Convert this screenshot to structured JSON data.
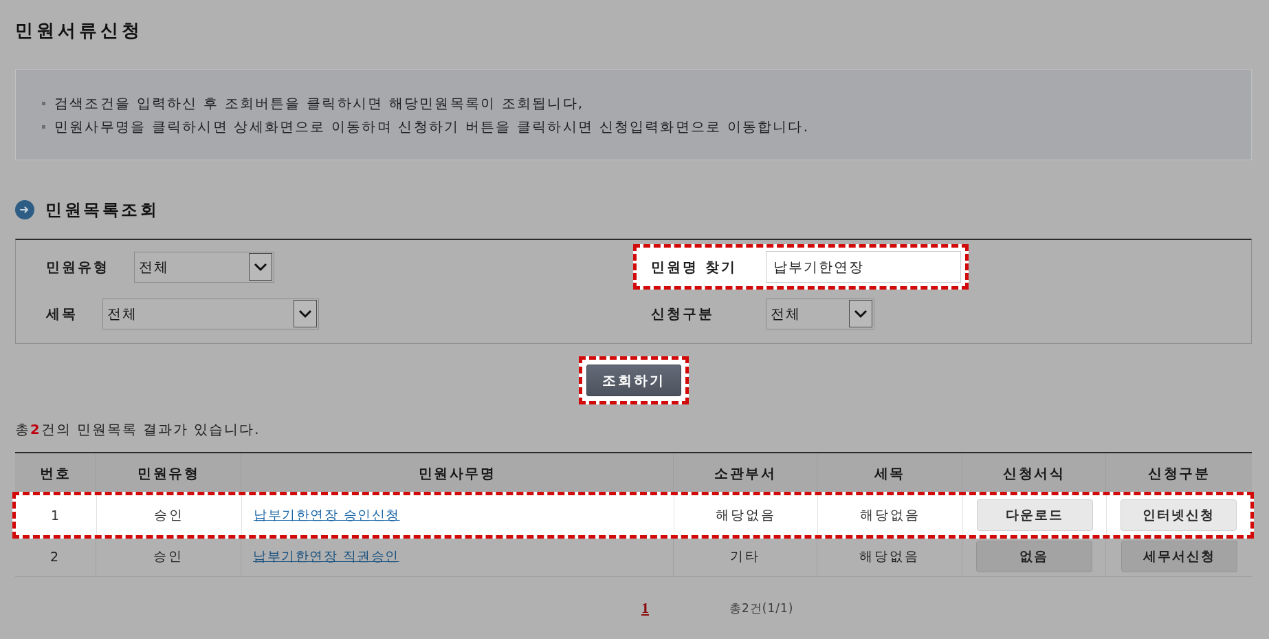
{
  "page_title": "민원서류신청",
  "notice": {
    "items": [
      "검색조건을 입력하신 후 조회버튼을 클릭하시면 해당민원목록이 조회됩니다,",
      "민원사무명을 클릭하시면 상세화면으로 이동하며 신청하기 버튼을 클릭하시면 신청입력화면으로 이동합니다."
    ]
  },
  "section": {
    "title": "민원목록조회"
  },
  "search_form": {
    "fields": [
      {
        "kind": "select",
        "label": "민원유형",
        "value": "전체",
        "highlighted": false
      },
      {
        "kind": "text",
        "label": "민원명 찾기",
        "value": "납부기한연장",
        "highlighted": true
      },
      {
        "kind": "select",
        "label": "세목",
        "value": "전체",
        "highlighted": false
      },
      {
        "kind": "select",
        "label": "신청구분",
        "value": "전체",
        "highlighted": false
      }
    ],
    "button": {
      "label": "조회하기",
      "highlighted": true
    }
  },
  "result_summary": "총**2**건의 민원목록 결과가 있습니다.",
  "table": {
    "columns": [
      "번호",
      "민원유형",
      "민원사무명",
      "소관부서",
      "세목",
      "신청서식",
      "신청구분"
    ],
    "rows": [
      {
        "number": "1",
        "type": "승인",
        "service_name": "납부기한연장 승인신청",
        "department": "해당없음",
        "tax_item": "해당없음",
        "form_button": "다운로드",
        "apply_button": "인터넷신청",
        "highlighted": true
      },
      {
        "number": "2",
        "type": "승인",
        "service_name": "납부기한연장 직권승인",
        "department": "기타",
        "tax_item": "해당없음",
        "form_button": "없음",
        "apply_button": "세무서신청",
        "highlighted": false
      }
    ]
  },
  "pagination": {
    "pages": [
      {
        "label": "1",
        "selected": true
      }
    ],
    "summary": "총2건(1/1)"
  }
}
